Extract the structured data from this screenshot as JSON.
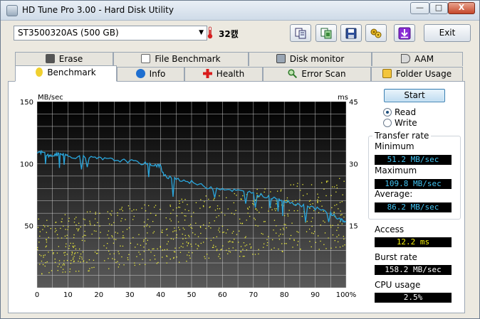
{
  "window": {
    "title": "HD Tune Pro 3.00 - Hard Disk Utility",
    "controls": {
      "minimize": "—",
      "maximize": "□",
      "close": "X"
    }
  },
  "toolbar": {
    "drive": "ST3500320AS (500 GB)",
    "temperature": "32캜",
    "buttons": [
      "copy-info-icon",
      "copy-screenshot-icon",
      "save-icon",
      "options-icon",
      "download-icon"
    ],
    "exit_label": "Exit"
  },
  "tabs": {
    "row1": [
      {
        "label": "Erase",
        "icon": "trash-icon"
      },
      {
        "label": "File Benchmark",
        "icon": "file-icon"
      },
      {
        "label": "Disk monitor",
        "icon": "monitor-icon"
      },
      {
        "label": "AAM",
        "icon": "speaker-icon"
      }
    ],
    "row2": [
      {
        "label": "Benchmark",
        "icon": "lightbulb-icon",
        "active": true
      },
      {
        "label": "Info",
        "icon": "info-icon"
      },
      {
        "label": "Health",
        "icon": "cross-icon"
      },
      {
        "label": "Error Scan",
        "icon": "magnifier-icon"
      },
      {
        "label": "Folder Usage",
        "icon": "folder-icon"
      }
    ]
  },
  "benchmark": {
    "start_label": "Start",
    "mode_options": [
      "Read",
      "Write"
    ],
    "selected_mode": "Read",
    "transfer_rate_title": "Transfer rate",
    "minimum_label": "Minimum",
    "minimum_value": "51.2 MB/sec",
    "maximum_label": "Maximum",
    "maximum_value": "109.8 MB/sec",
    "average_label": "Average:",
    "average_value": "86.2 MB/sec",
    "access_label": "Access",
    "access_value": "12.2 ms",
    "burst_label": "Burst rate",
    "burst_value": "158.2 MB/sec",
    "cpu_label": "CPU usage",
    "cpu_value": "2.5%"
  },
  "colors": {
    "transfer_line": "#2aa6dc",
    "access_dots": "#f0ef3a",
    "plot_background_top": "#000000",
    "plot_background_bottom": "#5a5a5a",
    "grid": "#d8d8d8"
  },
  "chart_data": {
    "type": "line",
    "ylabel_left": "MB/sec",
    "ylabel_right": "ms",
    "ylim_left": [
      0,
      150
    ],
    "ylim_right": [
      0,
      45
    ],
    "xlim": [
      0,
      100
    ],
    "x_tick_labels": [
      "0",
      "10",
      "20",
      "30",
      "40",
      "50",
      "60",
      "70",
      "80",
      "90",
      "100%"
    ],
    "y_left_tick_labels": [
      "150",
      "100",
      "50"
    ],
    "y_right_tick_labels": [
      "45",
      "30",
      "15"
    ],
    "grid": true,
    "series": [
      {
        "name": "Read",
        "axis": "left",
        "x": [
          0,
          2,
          4,
          6,
          8,
          10,
          15,
          20,
          25,
          30,
          35,
          38,
          40,
          41,
          45,
          50,
          55,
          60,
          65,
          70,
          75,
          78,
          80,
          85,
          90,
          95,
          98,
          100
        ],
        "values": [
          109,
          109,
          106,
          107,
          108,
          106,
          105,
          104,
          103,
          102,
          100,
          99,
          98,
          90,
          88,
          85,
          81,
          80,
          78,
          76,
          73,
          72,
          70,
          67,
          64,
          60,
          55,
          53
        ]
      },
      {
        "name": "Access time",
        "axis": "right",
        "type": "scatter",
        "x_range": [
          0,
          100
        ],
        "values_range_start": [
          3,
          17
        ],
        "values_range_end": [
          10,
          27
        ],
        "average": 12.2
      }
    ]
  }
}
